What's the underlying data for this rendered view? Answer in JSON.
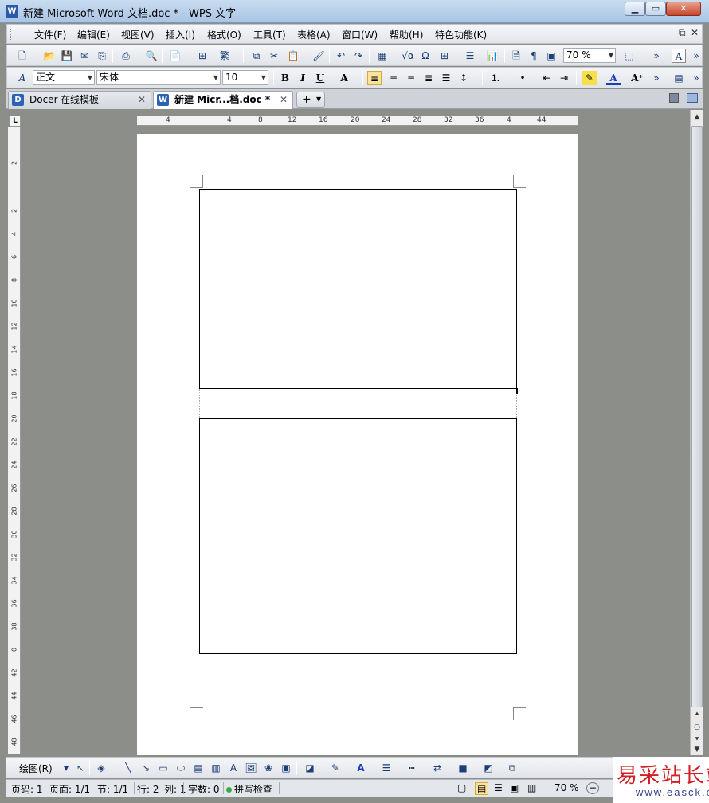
{
  "window": {
    "title": "新建 Microsoft Word 文档.doc * - WPS 文字",
    "app_icon": "W",
    "controls": {
      "minimize": "▁",
      "maximize": "▭",
      "close": "✕"
    }
  },
  "menu": {
    "items": [
      "文件(F)",
      "编辑(E)",
      "视图(V)",
      "插入(I)",
      "格式(O)",
      "工具(T)",
      "表格(A)",
      "窗口(W)",
      "帮助(H)",
      "特色功能(K)"
    ],
    "right_controls": [
      "‒",
      "⧉",
      "✕"
    ]
  },
  "toolbar_standard": {
    "zoom_value": "70 %",
    "overflow": "»"
  },
  "toolbar_format": {
    "style_value": "正文",
    "font_value": "宋体",
    "size_value": "10",
    "bold": "B",
    "italic": "I",
    "underline": "U",
    "overflow": "»"
  },
  "tabs": [
    {
      "icon": "D",
      "label": "Docer-在线模板",
      "close": "✕",
      "active": false
    },
    {
      "icon": "W",
      "label": "新建 Micr...档.doc *",
      "close": "✕",
      "active": true
    }
  ],
  "new_tab": "+",
  "ruler": {
    "horizontal_ticks": [
      "4",
      "4",
      "8",
      "12",
      "16",
      "20",
      "24",
      "28",
      "32",
      "36",
      "4",
      "44"
    ],
    "vertical_ticks": [
      "2",
      "2",
      "4",
      "6",
      "8",
      "10",
      "12",
      "14",
      "16",
      "18",
      "20",
      "22",
      "24",
      "26",
      "28",
      "30",
      "32",
      "34",
      "36",
      "38",
      "0",
      "42",
      "44",
      "46",
      "48"
    ],
    "corner": "L"
  },
  "drawing_toolbar": {
    "draw_label": "绘图(R)"
  },
  "status": {
    "page": "页码: 1",
    "pages": "页面: 1/1",
    "section": "节: 1/1",
    "row": "行: 2",
    "column": "列: 1",
    "word_count": "字数: 0",
    "spellcheck": "拼写检查",
    "zoom": "70 %"
  },
  "watermark": {
    "chinese": "易采站长站",
    "url": "www.easck.com"
  }
}
